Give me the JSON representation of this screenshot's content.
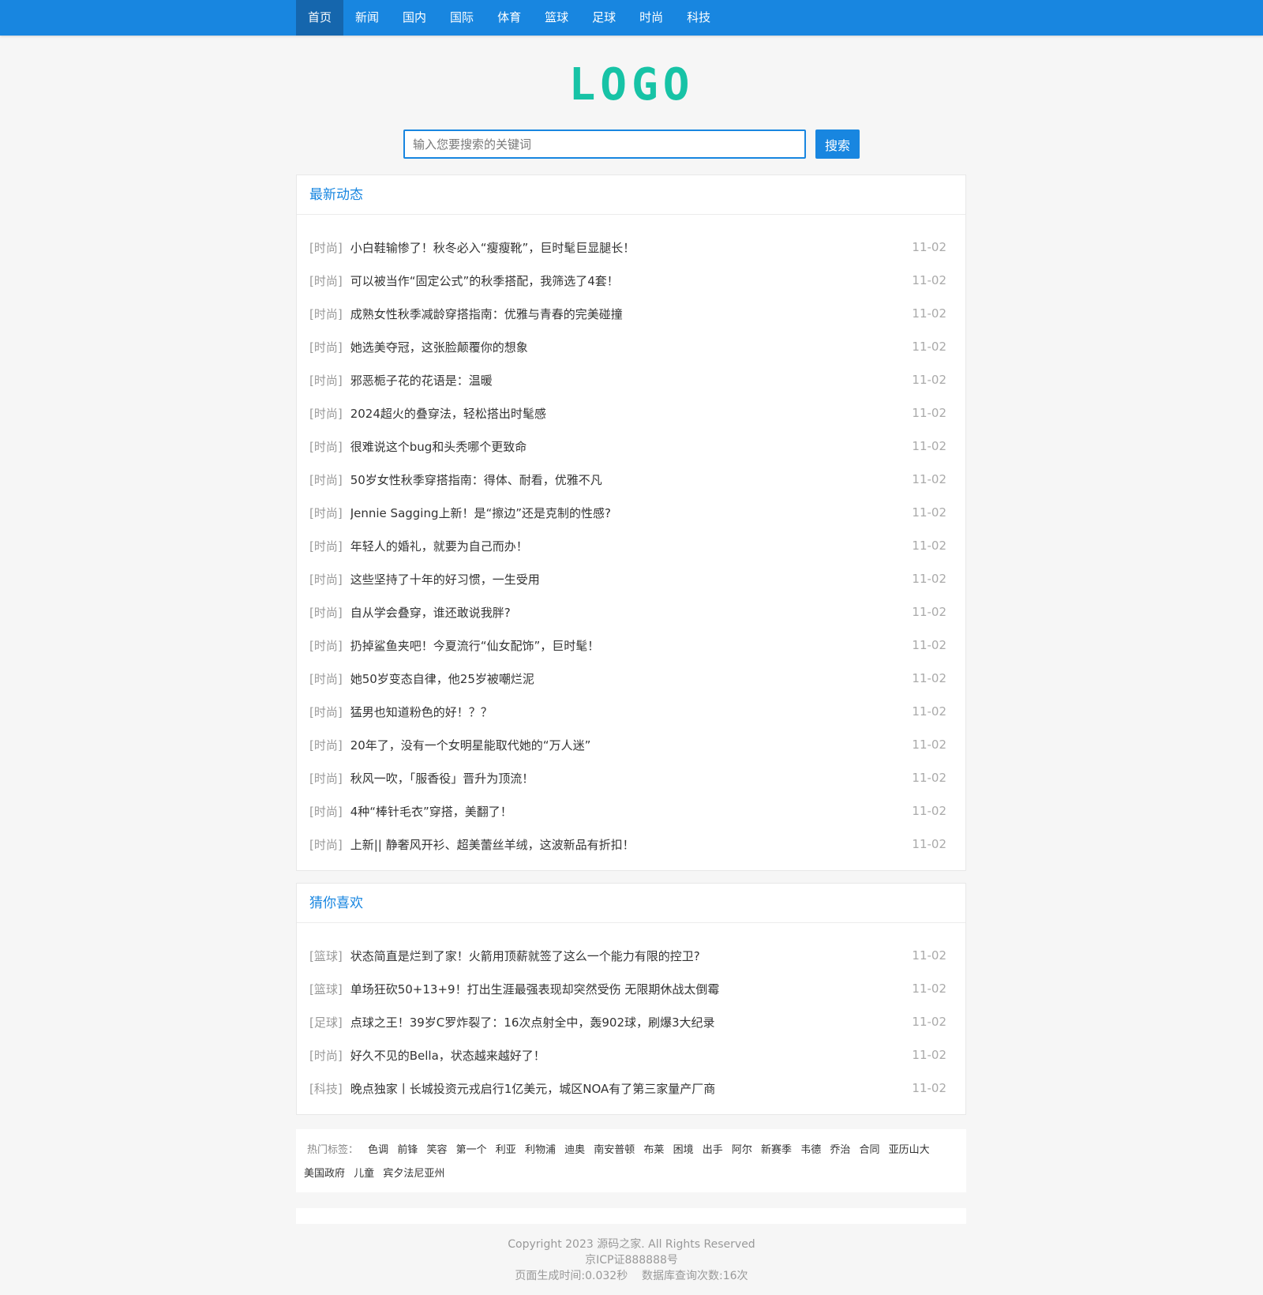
{
  "nav": {
    "items": [
      "首页",
      "新闻",
      "国内",
      "国际",
      "体育",
      "篮球",
      "足球",
      "时尚",
      "科技"
    ],
    "active_index": 0
  },
  "logo": "LOGO",
  "search": {
    "placeholder": "输入您要搜索的关键词",
    "button": "搜索"
  },
  "latest": {
    "title": "最新动态",
    "items": [
      {
        "tag": "[时尚]",
        "title": "小白鞋输惨了！秋冬必入“瘦瘦靴”，巨时髦巨显腿长！",
        "date": "11-02"
      },
      {
        "tag": "[时尚]",
        "title": "可以被当作“固定公式”的秋季搭配，我筛选了4套！",
        "date": "11-02"
      },
      {
        "tag": "[时尚]",
        "title": "成熟女性秋季减龄穿搭指南：优雅与青春的完美碰撞",
        "date": "11-02"
      },
      {
        "tag": "[时尚]",
        "title": "她选美夺冠，这张脸颠覆你的想象",
        "date": "11-02"
      },
      {
        "tag": "[时尚]",
        "title": "邪恶栀子花的花语是：温暖",
        "date": "11-02"
      },
      {
        "tag": "[时尚]",
        "title": "2024超火的叠穿法，轻松搭出时髦感",
        "date": "11-02"
      },
      {
        "tag": "[时尚]",
        "title": "很难说这个bug和头秃哪个更致命",
        "date": "11-02"
      },
      {
        "tag": "[时尚]",
        "title": "50岁女性秋季穿搭指南：得体、耐看，优雅不凡",
        "date": "11-02"
      },
      {
        "tag": "[时尚]",
        "title": "Jennie Sagging上新！是“擦边”还是克制的性感?",
        "date": "11-02"
      },
      {
        "tag": "[时尚]",
        "title": "年轻人的婚礼，就要为自己而办！",
        "date": "11-02"
      },
      {
        "tag": "[时尚]",
        "title": "这些坚持了十年的好习惯，一生受用",
        "date": "11-02"
      },
      {
        "tag": "[时尚]",
        "title": "自从学会叠穿，谁还敢说我胖?",
        "date": "11-02"
      },
      {
        "tag": "[时尚]",
        "title": "扔掉鲨鱼夹吧！今夏流行“仙女配饰”，巨时髦！",
        "date": "11-02"
      },
      {
        "tag": "[时尚]",
        "title": "她50岁变态自律，他25岁被嘲烂泥",
        "date": "11-02"
      },
      {
        "tag": "[时尚]",
        "title": "猛男也知道粉色的好！？？",
        "date": "11-02"
      },
      {
        "tag": "[时尚]",
        "title": "20年了，没有一个女明星能取代她的“万人迷”",
        "date": "11-02"
      },
      {
        "tag": "[时尚]",
        "title": "秋风一吹，「服香役」晋升为顶流！",
        "date": "11-02"
      },
      {
        "tag": "[时尚]",
        "title": "4种“棒针毛衣”穿搭，美翻了！",
        "date": "11-02"
      },
      {
        "tag": "[时尚]",
        "title": "上新|| 静奢风开衫、超美蕾丝羊绒，这波新品有折扣！",
        "date": "11-02"
      }
    ]
  },
  "guess": {
    "title": "猜你喜欢",
    "items": [
      {
        "tag": "[篮球]",
        "title": "状态简直是烂到了家！火箭用顶薪就签了这么一个能力有限的控卫?",
        "date": "11-02"
      },
      {
        "tag": "[篮球]",
        "title": "单场狂砍50+13+9！打出生涯最强表现却突然受伤 无限期休战太倒霉",
        "date": "11-02"
      },
      {
        "tag": "[足球]",
        "title": "点球之王！39岁C罗炸裂了：16次点射全中，轰902球，刷爆3大纪录",
        "date": "11-02"
      },
      {
        "tag": "[时尚]",
        "title": "好久不见的Bella，状态越来越好了！",
        "date": "11-02"
      },
      {
        "tag": "[科技]",
        "title": "晚点独家丨长城投资元戎启行1亿美元，城区NOA有了第三家量产厂商",
        "date": "11-02"
      }
    ]
  },
  "hot_tags": {
    "label": "热门标签：",
    "items": [
      "色调",
      "前锋",
      "笑容",
      "第一个",
      "利亚",
      "利物浦",
      "迪奥",
      "南安普顿",
      "布莱",
      "困境",
      "出手",
      "阿尔",
      "新赛季",
      "韦德",
      "乔治",
      "合同",
      "亚历山大",
      "美国政府",
      "儿童",
      "宾夕法尼亚州"
    ]
  },
  "footer": {
    "copyright": "Copyright 2023 源码之家. All Rights Reserved",
    "icp": "京ICP证888888号",
    "stats": "页面生成时间:0.032秒    数据库查询次数:16次"
  }
}
